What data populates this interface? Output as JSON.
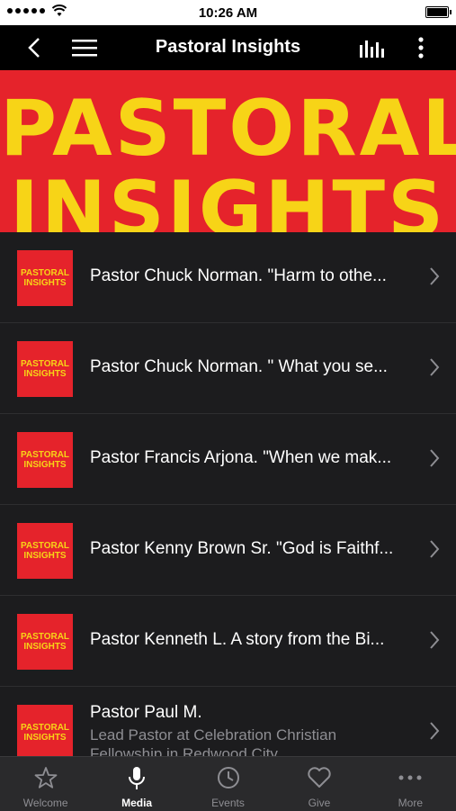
{
  "status_bar": {
    "time": "10:26 AM"
  },
  "nav": {
    "title": "Pastoral Insights"
  },
  "banner": {
    "line1": "PASTORAL",
    "line2": "INSIGHTS"
  },
  "thumb": {
    "line1": "PASTORAL",
    "line2": "INSIGHTS"
  },
  "items": [
    {
      "title": "Pastor Chuck Norman. \"Harm to othe..."
    },
    {
      "title": "Pastor Chuck Norman. \" What you se..."
    },
    {
      "title": "Pastor Francis Arjona. \"When we mak..."
    },
    {
      "title": "Pastor Kenny Brown Sr. \"God is Faithf..."
    },
    {
      "title": "Pastor Kenneth L. A story from the Bi..."
    },
    {
      "title": "Pastor Paul M.",
      "subtitle": "Lead Pastor at Celebration Christian Fellowship in Redwood City"
    }
  ],
  "tabs": [
    {
      "label": "Welcome",
      "icon": "star-icon"
    },
    {
      "label": "Media",
      "icon": "microphone-icon",
      "active": true
    },
    {
      "label": "Events",
      "icon": "clock-icon"
    },
    {
      "label": "Give",
      "icon": "heart-icon"
    },
    {
      "label": "More",
      "icon": "ellipsis-icon"
    }
  ],
  "colors": {
    "brand_red": "#e5232b",
    "brand_yellow": "#f7d417",
    "background": "#1c1c1e"
  }
}
